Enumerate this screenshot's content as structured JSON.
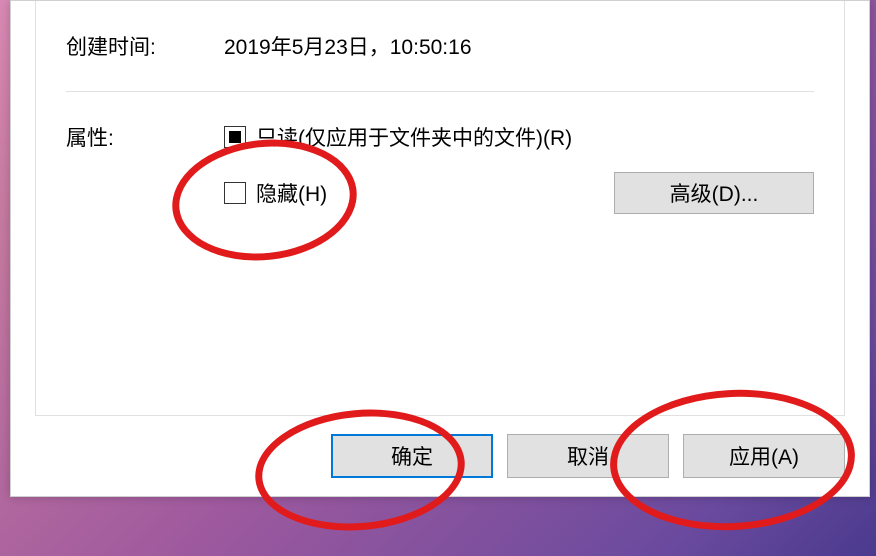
{
  "labels": {
    "created": "创建时间:",
    "attributes": "属性:"
  },
  "values": {
    "created_time": "2019年5月23日，10:50:16",
    "readonly_label": "只读(仅应用于文件夹中的文件)(R)",
    "hidden_label": "隐藏(H)"
  },
  "buttons": {
    "advanced": "高级(D)...",
    "ok": "确定",
    "cancel": "取消",
    "apply": "应用(A)"
  }
}
